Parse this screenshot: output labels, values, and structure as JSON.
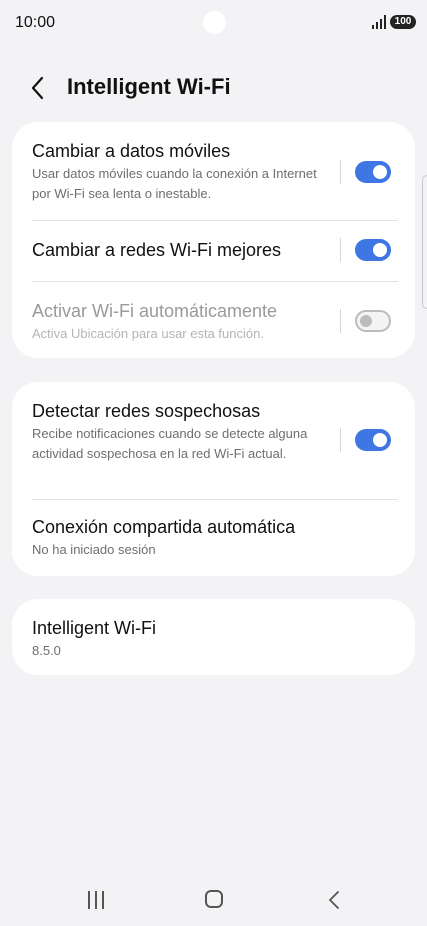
{
  "status": {
    "time": "10:00",
    "battery": "100"
  },
  "header": {
    "title": "Intelligent Wi-Fi"
  },
  "card1": {
    "row1": {
      "title": "Cambiar a datos móviles",
      "sub": "Usar datos móviles cuando la conexión a Internet por Wi-Fi sea lenta o inestable.",
      "enabled": true
    },
    "row2": {
      "title": "Cambiar a redes Wi-Fi mejores",
      "enabled": true
    },
    "row3": {
      "title": "Activar Wi-Fi automáticamente",
      "sub": "Activa Ubicación para usar esta función.",
      "enabled": false
    }
  },
  "card2": {
    "row1": {
      "title": "Detectar redes sospechosas",
      "sub": "Recibe notificaciones cuando se detecte alguna actividad sospechosa en la red Wi-Fi actual.",
      "enabled": true
    },
    "row2": {
      "title": "Conexión compartida automática",
      "sub": "No ha iniciado sesión"
    }
  },
  "card3": {
    "title": "Intelligent Wi-Fi",
    "version": "8.5.0"
  },
  "colors": {
    "accent": "#3e76e4",
    "background": "#f3f3f6",
    "card": "#ffffff"
  },
  "icons": {
    "back": "chevron-left-icon",
    "recents": "recent-apps-icon",
    "home": "home-icon",
    "nav_back": "nav-back-icon"
  }
}
